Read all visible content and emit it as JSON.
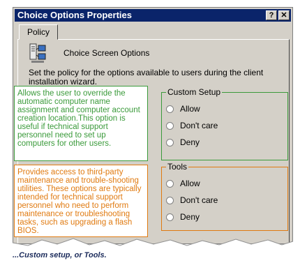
{
  "window": {
    "title": "Choice Options Properties",
    "help_label": "?",
    "close_label": "✕"
  },
  "tabs": [
    {
      "label": "Policy"
    }
  ],
  "policy": {
    "heading": "Choice Screen Options",
    "description": "Set the policy for the options available to users during the client installation wizard."
  },
  "custom_setup": {
    "label": "Custom Setup",
    "options": [
      "Allow",
      "Don't care",
      "Deny"
    ]
  },
  "tools": {
    "label": "Tools",
    "options": [
      "Allow",
      "Don't care",
      "Deny"
    ]
  },
  "callouts": {
    "custom_setup": "Allows the user to override the automatic computer name assignment and computer account creation location.This option is useful if technical support personnel need to set up computers for other users.",
    "tools": "Provides access to third-party maintenance and trouble-shooting utilities. These options are typically intended for technical support personnel who need to perform maintenance or troubleshooting tasks, such as upgrading a flash BIOS."
  },
  "caption": "...Custom setup, or Tools.",
  "colors": {
    "titlebar": "#0a246a",
    "window_face": "#d4d0c8",
    "custom_setup_highlight": "#3a9a3a",
    "tools_highlight": "#e07a10",
    "caption": "#1a2a5a"
  },
  "icons": {
    "policy": "computer-network-icon"
  }
}
